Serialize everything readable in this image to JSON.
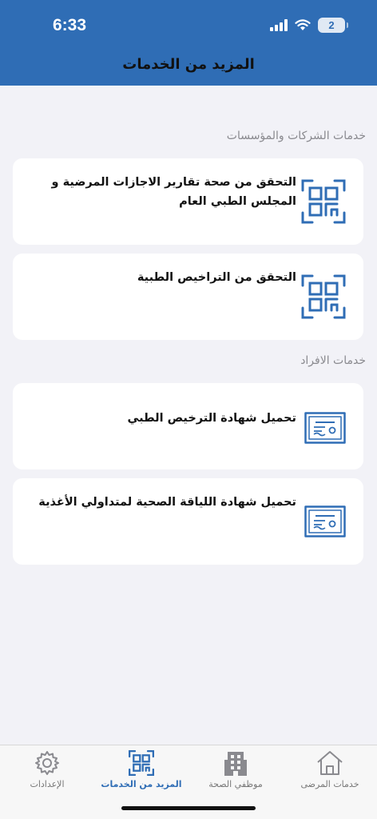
{
  "status_bar": {
    "time": "6:33",
    "battery": "2"
  },
  "header": {
    "title": "المزيد من الخدمات"
  },
  "sections": [
    {
      "title": "خدمات الشركات والمؤسسات",
      "cards": [
        {
          "text": "التحقق من صحة تقارير الاجازات المرضية و المجلس الطبي العام",
          "icon": "qr-code-icon"
        },
        {
          "text": "التحقق من التراخيص الطبية",
          "icon": "qr-code-icon"
        }
      ]
    },
    {
      "title": "خدمات الافراد",
      "cards": [
        {
          "text": "تحميل شهادة الترخيص الطبي",
          "icon": "certificate-icon"
        },
        {
          "text": "تحميل شهادة اللياقة الصحية لمتداولي الأغذية",
          "icon": "certificate-icon"
        }
      ]
    }
  ],
  "tabbar": {
    "items": [
      {
        "label": "خدمات المرضى",
        "icon": "house-icon",
        "active": false
      },
      {
        "label": "موظفي الصحة",
        "icon": "building-icon",
        "active": false
      },
      {
        "label": "المزيد من الخدمات",
        "icon": "qr-code-icon",
        "active": true
      },
      {
        "label": "الإعدادات",
        "icon": "gear-icon",
        "active": false
      }
    ]
  },
  "colors": {
    "primary": "#2f6db5",
    "background": "#f2f2f7",
    "card": "#ffffff"
  }
}
